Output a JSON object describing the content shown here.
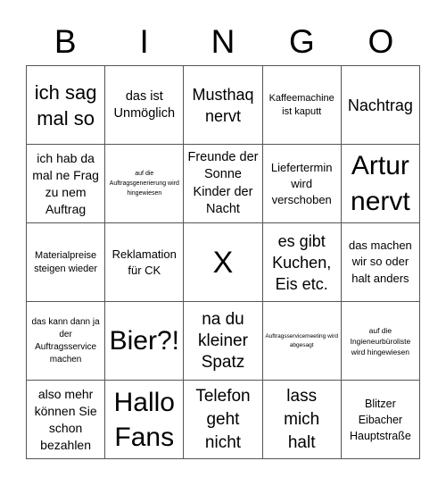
{
  "header": {
    "letters": [
      "B",
      "I",
      "N",
      "G",
      "O"
    ]
  },
  "grid": {
    "rows": [
      [
        {
          "text": "ich sag mal so"
        },
        {
          "text": "das ist Unmöglich"
        },
        {
          "text": "Musthaq nervt"
        },
        {
          "text": "Kaffeemachine ist kaputt"
        },
        {
          "text": "Nachtrag"
        }
      ],
      [
        {
          "text": "ich hab da mal ne Frag zu nem Auftrag"
        },
        {
          "text": "auf die Auftragsgenerierung wird hingewiesen"
        },
        {
          "text": "Freunde der Sonne Kinder der Nacht"
        },
        {
          "text": "Liefertermin wird verschoben"
        },
        {
          "text": "Artur nervt"
        }
      ],
      [
        {
          "text": "Materialpreise steigen wieder"
        },
        {
          "text": "Reklamation für CK"
        },
        {
          "text": "X"
        },
        {
          "text": "es gibt Kuchen, Eis etc."
        },
        {
          "text": "das machen wir so oder halt anders"
        }
      ],
      [
        {
          "text": "das kann dann ja der Auftragsservice machen"
        },
        {
          "text": "Bier?!"
        },
        {
          "text": "na du kleiner Spatz"
        },
        {
          "text": "Auftragsservicemeeting wird abgesagt"
        },
        {
          "text": "auf die Ingieneurbüroliste wird hingewiesen"
        }
      ],
      [
        {
          "text": "also mehr können Sie schon bezahlen"
        },
        {
          "text": "Hallo Fans"
        },
        {
          "text": "Telefon geht nicht"
        },
        {
          "text": "lass mich halt"
        },
        {
          "text": "Blitzer Eibacher Hauptstraße"
        }
      ]
    ]
  },
  "colors": {
    "border": "#555555",
    "background": "#ffffff",
    "text": "#000000"
  }
}
